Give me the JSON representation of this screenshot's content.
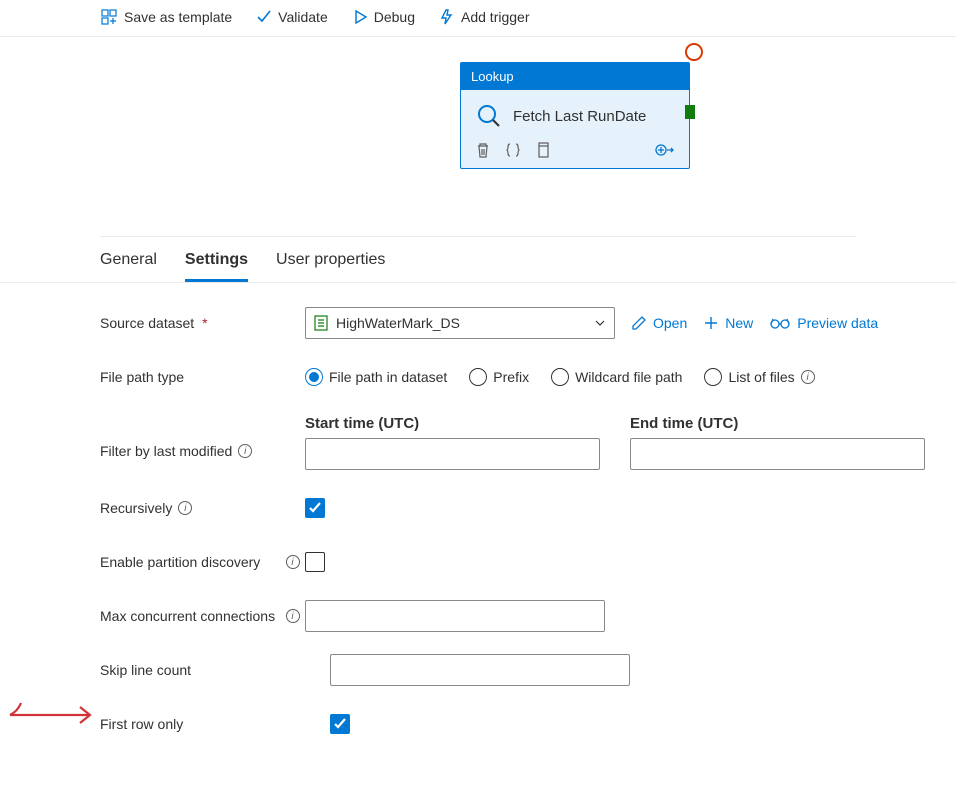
{
  "toolbar": {
    "save_template": "Save as template",
    "validate": "Validate",
    "debug": "Debug",
    "add_trigger": "Add trigger"
  },
  "activity": {
    "type": "Lookup",
    "name": "Fetch Last RunDate"
  },
  "tabs": {
    "general": "General",
    "settings": "Settings",
    "user_props": "User properties"
  },
  "settings": {
    "source_dataset_label": "Source dataset",
    "source_dataset_value": "HighWaterMark_DS",
    "open": "Open",
    "new": "New",
    "preview": "Preview data",
    "file_path_type_label": "File path type",
    "file_path_opts": {
      "in_dataset": "File path in dataset",
      "prefix": "Prefix",
      "wildcard": "Wildcard file path",
      "list": "List of files"
    },
    "start_time": "Start time (UTC)",
    "end_time": "End time (UTC)",
    "filter_modified": "Filter by last modified",
    "recursively": "Recursively",
    "enable_partition": "Enable partition discovery",
    "max_concurrent": "Max concurrent connections",
    "skip_line": "Skip line count",
    "first_row": "First row only"
  }
}
